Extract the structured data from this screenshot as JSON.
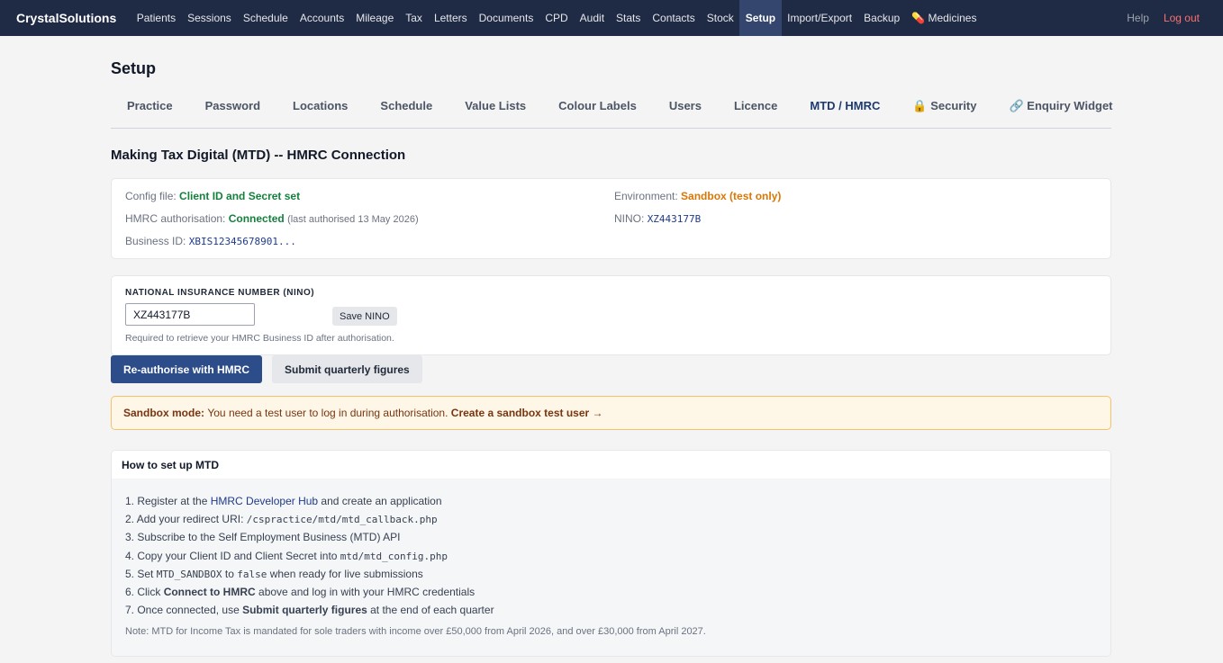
{
  "brand": "CrystalSolutions",
  "nav": {
    "items": [
      "Patients",
      "Sessions",
      "Schedule",
      "Accounts",
      "Mileage",
      "Tax",
      "Letters",
      "Documents",
      "CPD",
      "Audit",
      "Stats",
      "Contacts",
      "Stock",
      "Setup",
      "Import/Export",
      "Backup",
      "💊 Medicines"
    ],
    "active": "Setup",
    "help": "Help",
    "logout": "Log out"
  },
  "page_title": "Setup",
  "tabs": {
    "items": [
      "Practice",
      "Password",
      "Locations",
      "Schedule",
      "Value Lists",
      "Colour Labels",
      "Users",
      "Licence",
      "MTD / HMRC",
      "🔒 Security",
      "🔗 Enquiry Widget"
    ],
    "active": "MTD / HMRC"
  },
  "section_title": "Making Tax Digital (MTD) -- HMRC Connection",
  "status": {
    "config_label": "Config file:",
    "config_value": "Client ID and Secret set",
    "auth_label": "HMRC authorisation:",
    "auth_value": "Connected",
    "auth_note": "(last authorised 13 May 2026)",
    "business_label": "Business ID:",
    "business_value": "XBIS12345678901...",
    "env_label": "Environment:",
    "env_value": "Sandbox (test only)",
    "nino_label": "NINO:",
    "nino_value": "XZ443177B"
  },
  "nino_form": {
    "label": "NATIONAL INSURANCE NUMBER (NINO)",
    "value": "XZ443177B",
    "save_label": "Save NINO",
    "help": "Required to retrieve your HMRC Business ID after authorisation."
  },
  "actions": {
    "reauth_label": "Re-authorise with HMRC",
    "submit_label": "Submit quarterly figures"
  },
  "alert": {
    "strong": "Sandbox mode:",
    "text": "You need a test user to log in during authorisation.",
    "link": "Create a sandbox test user →"
  },
  "howto": {
    "title": "How to set up MTD",
    "step1_a": "Register at the ",
    "step1_link": "HMRC Developer Hub",
    "step1_b": " and create an application",
    "step2_a": "Add your redirect URI: ",
    "step2_code": "/cspractice/mtd/mtd_callback.php",
    "step3": "Subscribe to the Self Employment Business (MTD) API",
    "step4_a": "Copy your Client ID and Client Secret into ",
    "step4_code": "mtd/mtd_config.php",
    "step5_a": "Set ",
    "step5_code1": "MTD_SANDBOX",
    "step5_b": " to ",
    "step5_code2": "false",
    "step5_c": " when ready for live submissions",
    "step6_a": "Click ",
    "step6_strong": "Connect to HMRC",
    "step6_b": " above and log in with your HMRC credentials",
    "step7_a": "Once connected, use ",
    "step7_strong": "Submit quarterly figures",
    "step7_b": " at the end of each quarter",
    "note": "Note: MTD for Income Tax is mandated for sole traders with income over £50,000 from April 2026, and over £30,000 from April 2027."
  }
}
